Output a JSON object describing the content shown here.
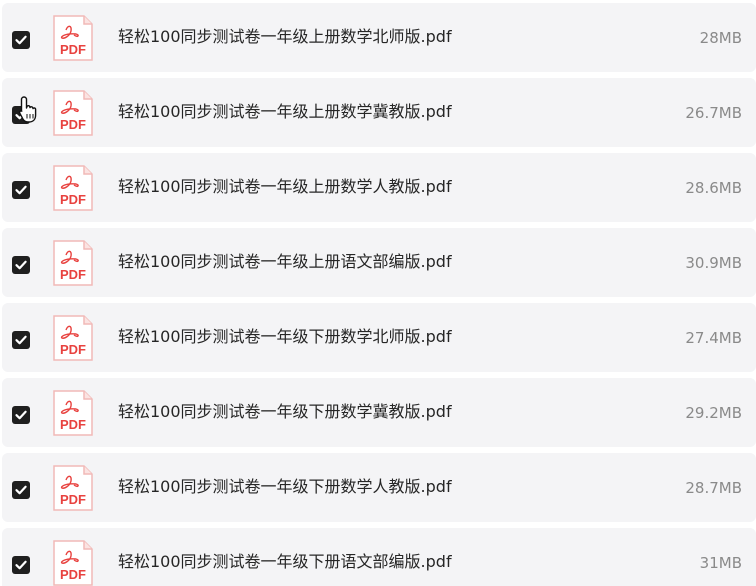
{
  "file_list": {
    "items": [
      {
        "name": "轻松100同步测试卷一年级上册数学北师版.pdf",
        "size": "28MB",
        "checked": true,
        "icon": "pdf-file-icon",
        "icon_label": "PDF"
      },
      {
        "name": "轻松100同步测试卷一年级上册数学冀教版.pdf",
        "size": "26.7MB",
        "checked": true,
        "icon": "pdf-file-icon",
        "icon_label": "PDF"
      },
      {
        "name": "轻松100同步测试卷一年级上册数学人教版.pdf",
        "size": "28.6MB",
        "checked": true,
        "icon": "pdf-file-icon",
        "icon_label": "PDF"
      },
      {
        "name": "轻松100同步测试卷一年级上册语文部编版.pdf",
        "size": "30.9MB",
        "checked": true,
        "icon": "pdf-file-icon",
        "icon_label": "PDF"
      },
      {
        "name": "轻松100同步测试卷一年级下册数学北师版.pdf",
        "size": "27.4MB",
        "checked": true,
        "icon": "pdf-file-icon",
        "icon_label": "PDF"
      },
      {
        "name": "轻松100同步测试卷一年级下册数学冀教版.pdf",
        "size": "29.2MB",
        "checked": true,
        "icon": "pdf-file-icon",
        "icon_label": "PDF"
      },
      {
        "name": "轻松100同步测试卷一年级下册数学人教版.pdf",
        "size": "28.7MB",
        "checked": true,
        "icon": "pdf-file-icon",
        "icon_label": "PDF"
      },
      {
        "name": "轻松100同步测试卷一年级下册语文部编版.pdf",
        "size": "31MB",
        "checked": true,
        "icon": "pdf-file-icon",
        "icon_label": "PDF"
      }
    ]
  },
  "colors": {
    "row_background": "#f4f4f6",
    "checkbox": "#1f1f1f",
    "pdf_accent": "#e8423f",
    "text": "#262626",
    "size_text": "#8a8a8a"
  },
  "cursor": {
    "icon": "hand-pointer-icon"
  }
}
